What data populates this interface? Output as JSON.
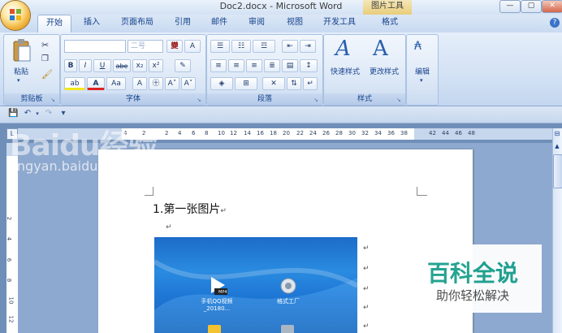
{
  "window": {
    "title": "Doc2.docx - Microsoft Word",
    "contextual_tab_group": "图片工具",
    "minimize": "—",
    "restore": "▢",
    "close": "✕"
  },
  "tabs": [
    {
      "label": "开始",
      "active": true
    },
    {
      "label": "插入"
    },
    {
      "label": "页面布局"
    },
    {
      "label": "引用"
    },
    {
      "label": "邮件"
    },
    {
      "label": "审阅"
    },
    {
      "label": "视图"
    },
    {
      "label": "开发工具"
    },
    {
      "label": "格式"
    }
  ],
  "ribbon": {
    "clipboard": {
      "label": "剪贴板",
      "paste": "粘贴"
    },
    "font": {
      "label": "字体",
      "font_name": "",
      "font_size": "二号",
      "grow": "A",
      "shrink": "A",
      "bold": "B",
      "italic": "I",
      "underline": "U",
      "strike": "abe",
      "subscript": "x₂",
      "superscript": "x²",
      "color": "A",
      "size_char": "Aa"
    },
    "paragraph": {
      "label": "段落"
    },
    "styles": {
      "label": "样式",
      "quick_styles": "快速样式",
      "change_styles": "更改样式"
    },
    "editing": {
      "label": "编辑"
    }
  },
  "ruler": {
    "h_numbers": [
      "4",
      "2",
      "2",
      "4",
      "6",
      "8",
      "10",
      "12",
      "14",
      "16",
      "18",
      "20",
      "22",
      "24",
      "26",
      "28",
      "30",
      "32",
      "34",
      "36",
      "38",
      "42",
      "44",
      "46",
      "48"
    ],
    "v_numbers": [
      "2",
      "4",
      "6",
      "8",
      "10",
      "12"
    ]
  },
  "document": {
    "paragraph1": "1.第一张图片",
    "picture_icons": [
      {
        "label": "手机QQ视频_20180...",
        "badge": "MP4"
      },
      {
        "label": "格式工厂"
      }
    ]
  },
  "watermark": {
    "baidu": "Baidu经验",
    "url": "jingyan.baidu.com"
  },
  "badge": {
    "title": "百科全说",
    "subtitle": "助你轻松解决"
  },
  "colors": {
    "accent": "#15428b",
    "ribbon_bg": "#cfdff3",
    "badge_green": "#1aa08c"
  }
}
